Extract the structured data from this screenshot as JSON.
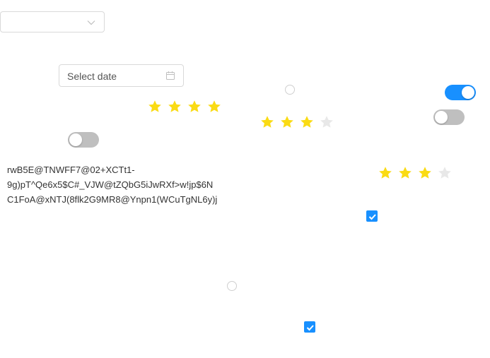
{
  "colors": {
    "primary": "#1890ff",
    "star_filled": "#fadb14",
    "star_empty": "#e8e8e8",
    "switch_off": "#bfbfbf",
    "border": "#d9d9d9"
  },
  "select": {
    "value": "",
    "icon": "chevron-down-icon"
  },
  "datepicker": {
    "placeholder": "Select date",
    "icon": "calendar-icon"
  },
  "radios": [
    {
      "id": "radio-1",
      "checked": false
    },
    {
      "id": "radio-2",
      "checked": false
    }
  ],
  "switches": [
    {
      "id": "switch-top-right",
      "on": true
    },
    {
      "id": "switch-mid-right",
      "on": false
    },
    {
      "id": "switch-left",
      "on": false
    }
  ],
  "ratings": [
    {
      "id": "rating-1",
      "value": 4,
      "count": 4
    },
    {
      "id": "rating-2",
      "value": 3,
      "count": 4
    },
    {
      "id": "rating-3",
      "value": 3,
      "count": 4
    }
  ],
  "checkboxes": [
    {
      "id": "checkbox-1",
      "checked": true
    },
    {
      "id": "checkbox-2",
      "checked": true
    }
  ],
  "text": {
    "lines": [
      "rwB5E@TNWFF7@02+XCTt1-",
      "9g)pT^Qe6x5$C#_VJW@tZQbG5iJwRXf>w!jp$6N",
      "C1FoA@xNTJ(8flk2G9MR8@Ynpn1(WCuTgNL6y)j"
    ]
  }
}
